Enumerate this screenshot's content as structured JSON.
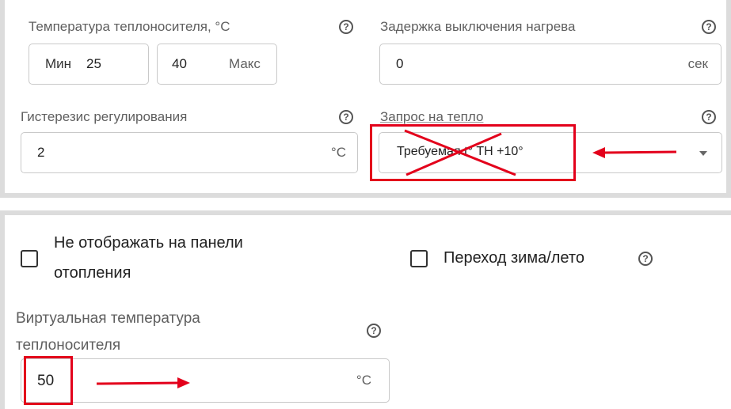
{
  "heating_settings": {
    "coolant_temp_label": "Температура теплоносителя, °С",
    "min_label": "Мин",
    "min_value": "25",
    "max_value": "40",
    "max_label": "Макс",
    "shutdown_delay_label": "Задержка выключения нагрева",
    "shutdown_delay_value": "0",
    "shutdown_delay_unit": "сек",
    "hysteresis_label": "Гистерезис регулирования",
    "hysteresis_value": "2",
    "hysteresis_unit": "°С",
    "heat_request_label": "Запрос на тепло",
    "heat_request_value": "Требуемая t° ТН +10°"
  },
  "display_settings": {
    "hide_on_panel_label_line1": "Не отображать на панели",
    "hide_on_panel_label_line2": "отопления",
    "hide_on_panel_checked": false,
    "winter_summer_label": "Переход зима/лето",
    "winter_summer_checked": false,
    "virtual_temp_label_line1": "Виртуальная температура",
    "virtual_temp_label_line2": "теплоносителя",
    "virtual_temp_value": "50",
    "virtual_temp_unit": "°С"
  },
  "help_glyph": "?",
  "annotation_color": "#e3001b"
}
